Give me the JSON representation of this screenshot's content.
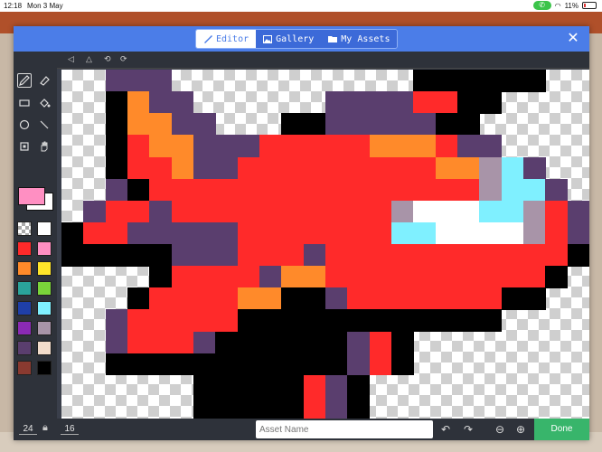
{
  "status": {
    "time": "12:18",
    "date": "Mon 3 May",
    "battery": "11%"
  },
  "tabs": [
    {
      "label": "Editor",
      "icon": "paintbrush-icon",
      "active": true
    },
    {
      "label": "Gallery",
      "icon": "image-icon",
      "active": false
    },
    {
      "label": "My Assets",
      "icon": "folder-icon",
      "active": false
    }
  ],
  "close_icon": "close-icon",
  "bottom": {
    "width": "24",
    "height": "16",
    "asset_placeholder": "Asset Name",
    "done_label": "Done"
  },
  "palette": [
    "transparent",
    "#ffffff",
    "#ff2a2a",
    "#ff8fc2",
    "#ff8a2a",
    "#ffe52a",
    "#2aa39b",
    "#7ad43a",
    "#1f3fa8",
    "#7ff0ff",
    "#8a2ab5",
    "#a894a8",
    "#5a3e6e",
    "#f2dccb",
    "#8a3a30",
    "#000000"
  ],
  "colors": {
    "foreground": "#ff8fc2",
    "background": "#ffffff",
    "accent": "#4b7de8",
    "done": "#38b56b"
  },
  "sprite": {
    "cols": 24,
    "rows": 16,
    "legend": {
      "K": "#000000",
      "P": "#5a3e6e",
      "R": "#ff2a2a",
      "O": "#ff8a2a",
      "C": "#7ff0ff",
      "W": "#ffffff",
      "L": "#a894a8"
    },
    "grid": [
      "..PPP...........KKKKKK..",
      "..KOPP......PPPPRRKK....",
      "..KOOPP...KKPPPPPKK.....",
      "..KROOPPPRRRRROOORPP....",
      "..KRROPPRRRRRRRRROOLCP..",
      "..PKRRRRRRRRRRRRRRRLCCP.",
      ".PRRPRRRRRRRRRRLWWWCCLRP",
      "KRRPPPPPRRRRRRRCCWWWWLRP",
      "KKKKKPPPRRRPRRRRRRRRRRRK",
      "....KRRRRPOORRRRRRRRRRK.",
      "...KRRRROOKKPRRRRRRRKK..",
      "..PRRRRRKKKKKKKKKKKK....",
      "..PRRRPKKKKKKPRK........",
      "..KKKKKKKKKKKPRK........",
      "......KKKKKRPK..........",
      "......KKKKKRPK.........."
    ]
  }
}
